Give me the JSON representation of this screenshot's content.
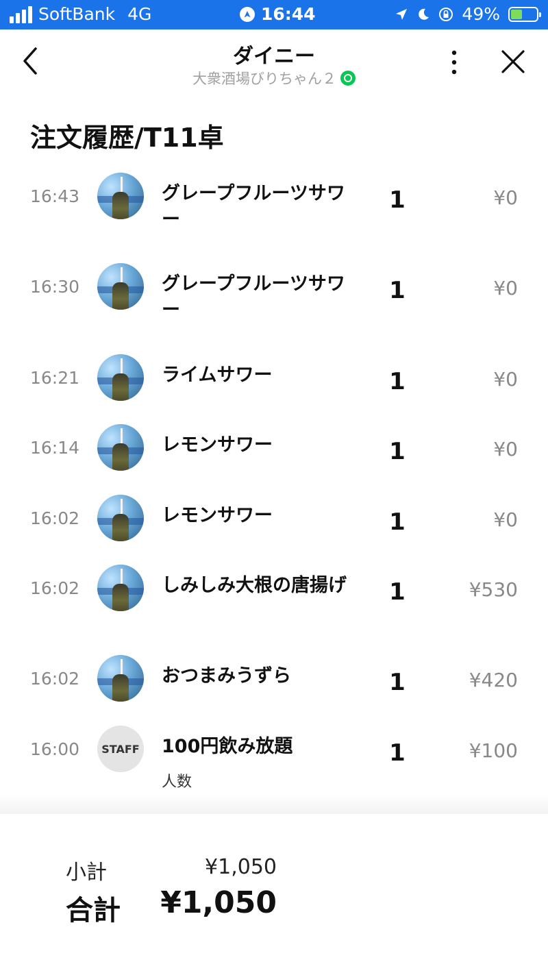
{
  "status_bar": {
    "carrier": "SoftBank",
    "network": "4G",
    "time": "16:44",
    "battery_percent": "49%",
    "battery_level": 0.49,
    "background_color": "#1a73e8"
  },
  "header": {
    "title": "ダイニー",
    "subtitle": "大衆酒場びりちゃん２",
    "verified_icon": "verified-badge-icon",
    "back_icon": "chevron-left-icon",
    "more_icon": "more-vertical-icon",
    "close_icon": "close-icon"
  },
  "page_title": "注文履歴/T11卓",
  "orders": [
    {
      "time": "16:43",
      "avatar": "user-photo",
      "name": "グレープフルーツサワー",
      "qty": "1",
      "price": "¥0"
    },
    {
      "time": "16:30",
      "avatar": "user-photo",
      "name": "グレープフルーツサワー",
      "qty": "1",
      "price": "¥0"
    },
    {
      "time": "16:21",
      "avatar": "user-photo",
      "name": "ライムサワー",
      "qty": "1",
      "price": "¥0"
    },
    {
      "time": "16:14",
      "avatar": "user-photo",
      "name": "レモンサワー",
      "qty": "1",
      "price": "¥0"
    },
    {
      "time": "16:02",
      "avatar": "user-photo",
      "name": "レモンサワー",
      "qty": "1",
      "price": "¥0"
    },
    {
      "time": "16:02",
      "avatar": "user-photo",
      "name": "しみしみ大根の唐揚げ",
      "qty": "1",
      "price": "¥530"
    },
    {
      "time": "16:02",
      "avatar": "user-photo",
      "name": "おつまみうずら",
      "qty": "1",
      "price": "¥420"
    },
    {
      "time": "16:00",
      "avatar": "STAFF",
      "name": "100円飲み放題",
      "sub": "人数",
      "qty": "1",
      "price": "¥100"
    }
  ],
  "totals": {
    "subtotal_label": "小計",
    "subtotal_value": "¥1,050",
    "total_label": "合計",
    "total_value": "¥1,050"
  }
}
